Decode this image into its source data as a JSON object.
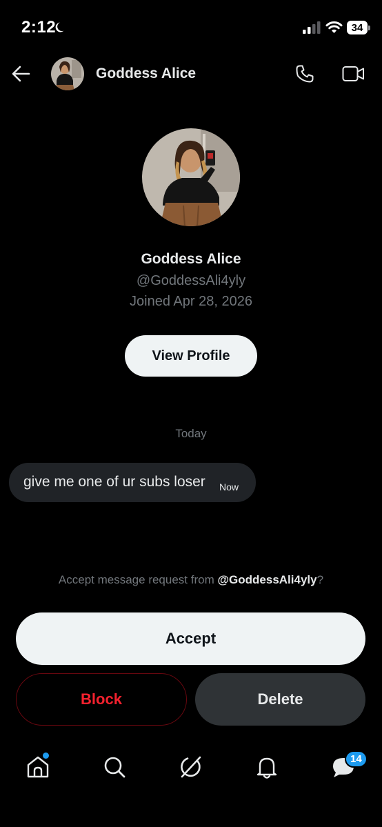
{
  "status_bar": {
    "time": "2:12",
    "battery": "34"
  },
  "header": {
    "name": "Goddess Alice"
  },
  "profile": {
    "name": "Goddess Alice",
    "handle": "@GoddessAli4yly",
    "joined": "Joined Apr 28, 2026",
    "view_profile_label": "View Profile"
  },
  "conversation": {
    "day_label": "Today",
    "messages": [
      {
        "text": "give me one of ur subs loser",
        "time": "Now"
      }
    ]
  },
  "request": {
    "prompt_prefix": "Accept message request from ",
    "handle": "@GoddessAli4yly",
    "prompt_suffix": "?",
    "accept_label": "Accept",
    "block_label": "Block",
    "delete_label": "Delete"
  },
  "bottom_nav": {
    "items": [
      {
        "icon": "home-icon",
        "has_dot": true
      },
      {
        "icon": "search-icon"
      },
      {
        "icon": "grok-icon"
      },
      {
        "icon": "notifications-icon"
      },
      {
        "icon": "messages-icon",
        "badge": "14"
      }
    ]
  },
  "colors": {
    "background": "#000000",
    "primary_text": "#e7e9ea",
    "secondary_text": "#71767b",
    "accent_blue": "#1d9bf0",
    "block_red": "#f4212e",
    "bubble": "#202327",
    "delete_button": "#2f3336",
    "light_button": "#eff3f4"
  }
}
